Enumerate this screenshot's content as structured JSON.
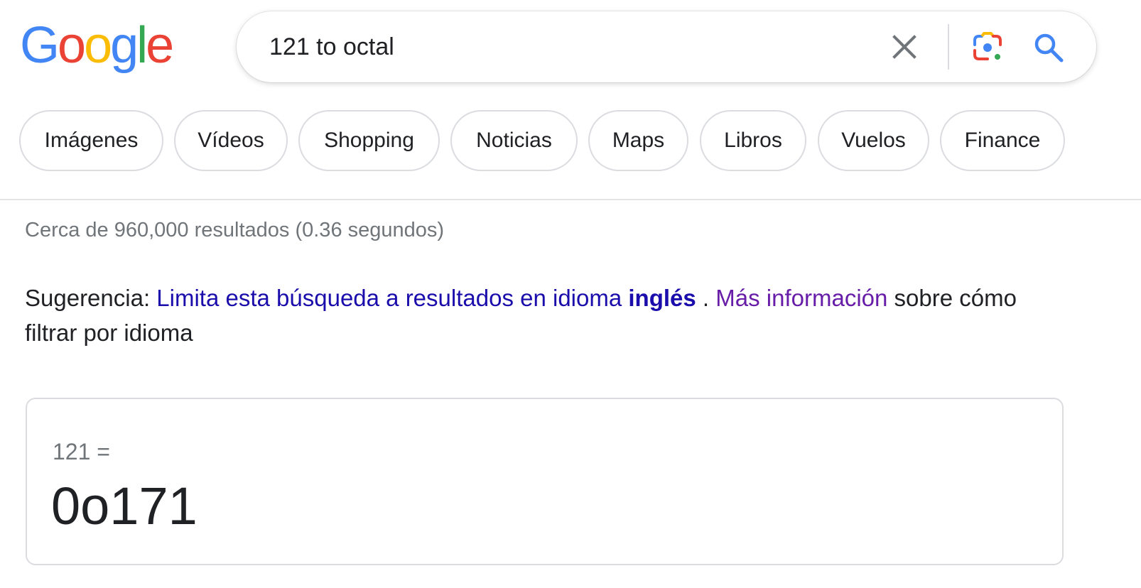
{
  "logo": {
    "letters": [
      "G",
      "o",
      "o",
      "g",
      "l",
      "e"
    ]
  },
  "search": {
    "query": "121 to octal"
  },
  "icons": {
    "clear": "close-icon",
    "lens": "google-lens-camera-icon",
    "search": "magnifier-search-icon"
  },
  "chips": [
    {
      "label": "Imágenes"
    },
    {
      "label": "Vídeos"
    },
    {
      "label": "Shopping"
    },
    {
      "label": "Noticias"
    },
    {
      "label": "Maps"
    },
    {
      "label": "Libros"
    },
    {
      "label": "Vuelos"
    },
    {
      "label": "Finance"
    }
  ],
  "results": {
    "stats": "Cerca de 960,000 resultados (0.36 segundos)"
  },
  "suggestion": {
    "prefix": "Sugerencia:",
    "link_text": "Limita esta búsqueda a resultados en idioma",
    "language": "inglés",
    "separator": ".",
    "more_info": "Más información",
    "suffix": "sobre cómo filtrar por idioma"
  },
  "answer": {
    "expression": "121 =",
    "result": "0o171"
  },
  "colors": {
    "logo_blue": "#4285f4",
    "logo_red": "#ea4335",
    "logo_yellow": "#fbbc05",
    "logo_green": "#34a853",
    "link_blue": "#1a0dab",
    "link_visited": "#681da8",
    "muted_text": "#70757a",
    "text": "#202124",
    "border": "#dadce0"
  }
}
